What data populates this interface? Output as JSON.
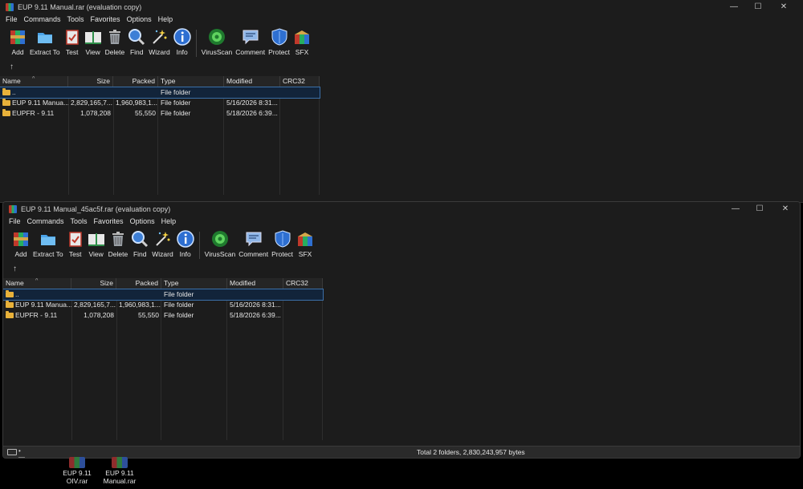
{
  "windows": [
    {
      "title": "EUP 9.11 Manual.rar (evaluation copy)",
      "controls": {
        "minimize": "—",
        "maximize": "☐",
        "close": "✕"
      },
      "menu": [
        "File",
        "Commands",
        "Tools",
        "Favorites",
        "Options",
        "Help"
      ],
      "toolbar": [
        "Add",
        "Extract To",
        "Test",
        "View",
        "Delete",
        "Find",
        "Wizard",
        "Info",
        "VirusScan",
        "Comment",
        "Protect",
        "SFX"
      ],
      "columns": [
        "Name",
        "Size",
        "Packed",
        "Type",
        "Modified",
        "CRC32"
      ],
      "rows": [
        {
          "name": "..",
          "size": "",
          "packed": "",
          "type": "File folder",
          "modified": "",
          "crc": ""
        },
        {
          "name": "EUP 9.11 Manua...",
          "size": "2,829,165,7...",
          "packed": "1,960,983,1...",
          "type": "File folder",
          "modified": "5/16/2026 8:31...",
          "crc": ""
        },
        {
          "name": "EUPFR - 9.11",
          "size": "1,078,208",
          "packed": "55,550",
          "type": "File folder",
          "modified": "5/18/2026 6:39...",
          "crc": ""
        }
      ]
    },
    {
      "title": "EUP 9.11 Manual_45ac5f.rar (evaluation copy)",
      "controls": {
        "minimize": "—",
        "maximize": "☐",
        "close": "✕"
      },
      "menu": [
        "File",
        "Commands",
        "Tools",
        "Favorites",
        "Options",
        "Help"
      ],
      "toolbar": [
        "Add",
        "Extract To",
        "Test",
        "View",
        "Delete",
        "Find",
        "Wizard",
        "Info",
        "VirusScan",
        "Comment",
        "Protect",
        "SFX"
      ],
      "columns": [
        "Name",
        "Size",
        "Packed",
        "Type",
        "Modified",
        "CRC32"
      ],
      "rows": [
        {
          "name": "..",
          "size": "",
          "packed": "",
          "type": "File folder",
          "modified": "",
          "crc": ""
        },
        {
          "name": "EUP 9.11 Manua...",
          "size": "2,829,165,7...",
          "packed": "1,960,983,1...",
          "type": "File folder",
          "modified": "5/16/2026 8:31...",
          "crc": ""
        },
        {
          "name": "EUPFR - 9.11",
          "size": "1,078,208",
          "packed": "55,550",
          "type": "File folder",
          "modified": "5/18/2026 6:39...",
          "crc": ""
        }
      ],
      "status": "Total 2 folders, 2,830,243,957 bytes"
    }
  ],
  "desktop": [
    {
      "line1": "EUP 9.11",
      "line2": "OIV.rar"
    },
    {
      "line1": "EUP 9.11",
      "line2": "Manual.rar"
    }
  ],
  "colors": {
    "background": "#000000",
    "window": "#1c1c1c",
    "selection": "#3b6fa8",
    "folder": "#e8b13a"
  }
}
